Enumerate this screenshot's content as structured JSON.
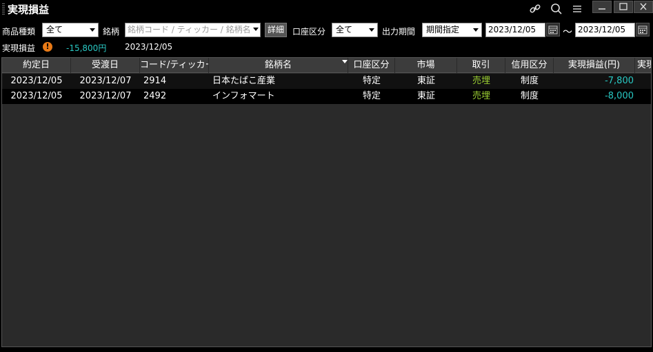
{
  "window": {
    "title": "実現損益"
  },
  "titlebar_icons": [
    "link-icon",
    "search-icon",
    "menu-icon"
  ],
  "filters": {
    "product_type_label": "商品種類",
    "product_type_value": "全て",
    "symbol_label": "銘柄",
    "symbol_placeholder": "銘柄コード / ティッカー / 銘柄名",
    "detail_button": "詳細",
    "account_label": "口座区分",
    "account_value": "全て",
    "period_label": "出力期間",
    "period_value": "期間指定",
    "date_from": "2023/12/05",
    "tilde": "～",
    "date_to": "2023/12/05"
  },
  "summary": {
    "label": "実現損益",
    "warning": "!",
    "amount": "-15,800円",
    "date": "2023/12/05"
  },
  "table": {
    "columns": [
      "約定日",
      "受渡日",
      "コード/ティッカー",
      "銘柄名",
      "口座区分",
      "市場",
      "取引",
      "信用区分",
      "実現損益(円)",
      "実現"
    ],
    "rows": [
      {
        "trade_date": "2023/12/05",
        "settle_date": "2023/12/07",
        "code": "2914",
        "name": "日本たばこ産業",
        "account": "特定",
        "market": "東証",
        "trade": "売埋",
        "margin": "制度",
        "pnl": "-7,800"
      },
      {
        "trade_date": "2023/12/05",
        "settle_date": "2023/12/07",
        "code": "2492",
        "name": "インフォマート",
        "account": "特定",
        "market": "東証",
        "trade": "売埋",
        "margin": "制度",
        "pnl": "-8,000"
      }
    ]
  },
  "colors": {
    "negative": "#29c9c4",
    "trade": "#9acd32",
    "background": "#000000",
    "grid_background": "#2a2a2a",
    "header_background": "#3c3c3c",
    "warning": "#e87a17"
  }
}
